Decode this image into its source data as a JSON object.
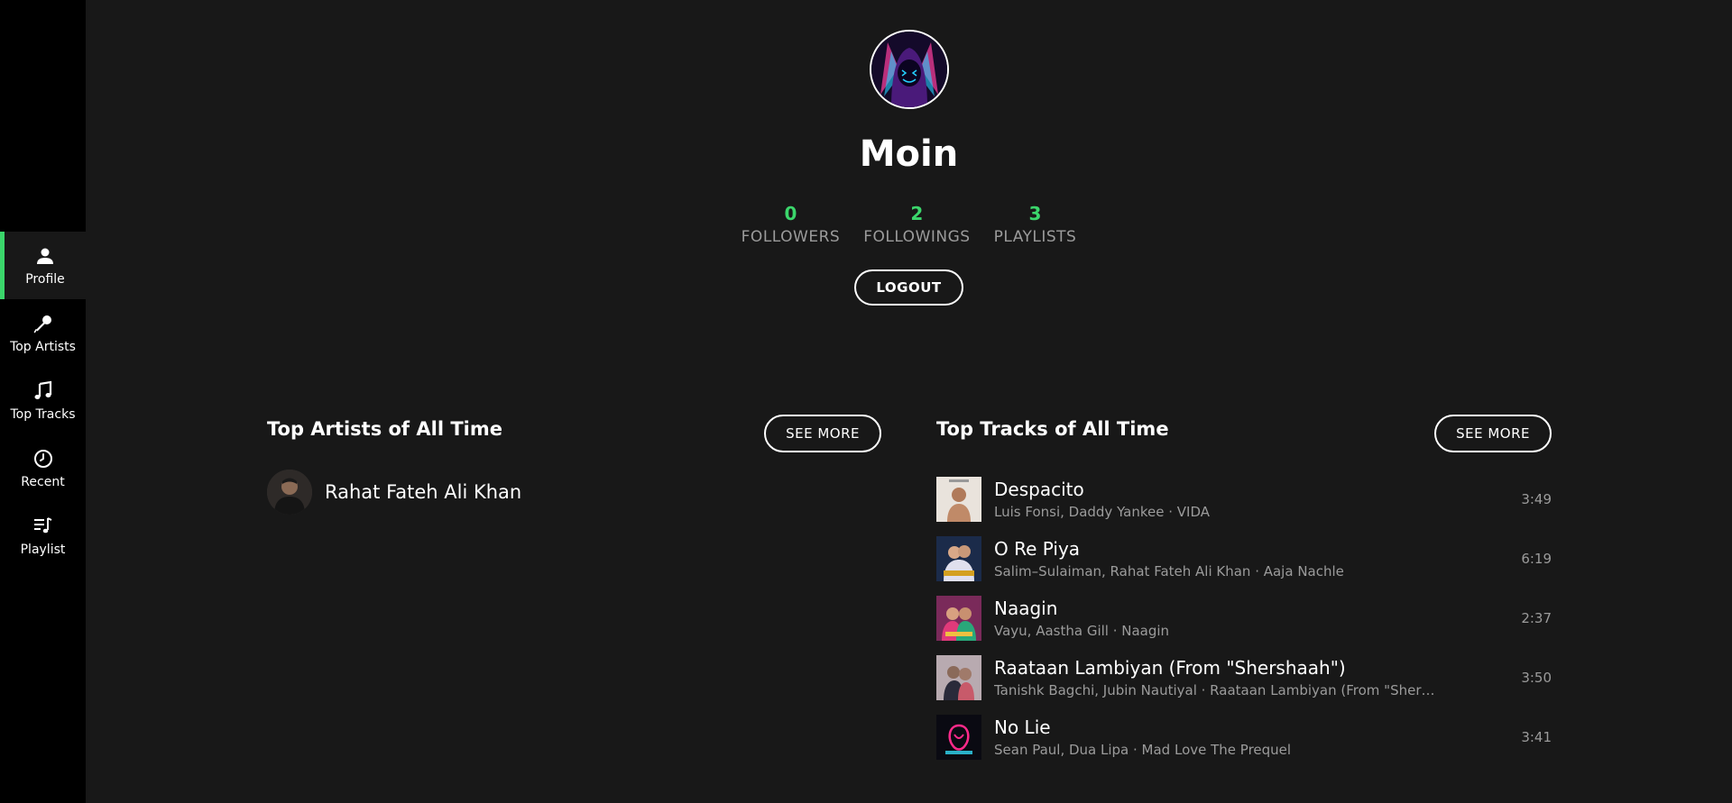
{
  "sidebar": {
    "items": [
      {
        "label": "Profile",
        "icon": "user-icon",
        "active": true
      },
      {
        "label": "Top Artists",
        "icon": "microphone-icon",
        "active": false
      },
      {
        "label": "Top Tracks",
        "icon": "music-note-icon",
        "active": false
      },
      {
        "label": "Recent",
        "icon": "clock-icon",
        "active": false
      },
      {
        "label": "Playlist",
        "icon": "playlist-icon",
        "active": false
      }
    ],
    "accent_color": "#3bd66b"
  },
  "profile": {
    "name": "Moin",
    "stats": [
      {
        "value": "0",
        "label": "FOLLOWERS"
      },
      {
        "value": "2",
        "label": "FOLLOWINGS"
      },
      {
        "value": "3",
        "label": "PLAYLISTS"
      }
    ],
    "logout_label": "LOGOUT"
  },
  "top_artists": {
    "title": "Top Artists of All Time",
    "see_more_label": "SEE MORE",
    "items": [
      {
        "name": "Rahat Fateh Ali Khan"
      }
    ]
  },
  "top_tracks": {
    "title": "Top Tracks of All Time",
    "see_more_label": "SEE MORE",
    "items": [
      {
        "title": "Despacito",
        "subtitle": "Luis Fonsi, Daddy Yankee · VIDA",
        "duration": "3:49"
      },
      {
        "title": "O Re Piya",
        "subtitle": "Salim–Sulaiman, Rahat Fateh Ali Khan · Aaja Nachle",
        "duration": "6:19"
      },
      {
        "title": "Naagin",
        "subtitle": "Vayu, Aastha Gill · Naagin",
        "duration": "2:37"
      },
      {
        "title": "Raataan Lambiyan (From \"Shershaah\")",
        "subtitle": "Tanishk Bagchi, Jubin Nautiyal · Raataan Lambiyan (From \"Shers...",
        "duration": "3:50"
      },
      {
        "title": "No Lie",
        "subtitle": "Sean Paul, Dua Lipa · Mad Love The Prequel",
        "duration": "3:41"
      }
    ]
  },
  "colors": {
    "background": "#181818",
    "sidebar": "#000000",
    "accent": "#3bd66b",
    "muted_text": "#9b9b9b"
  }
}
